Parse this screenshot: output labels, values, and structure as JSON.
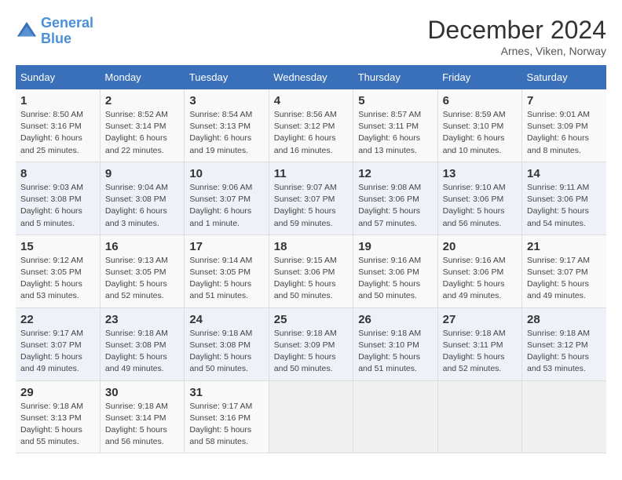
{
  "logo": {
    "line1": "General",
    "line2": "Blue"
  },
  "title": "December 2024",
  "subtitle": "Arnes, Viken, Norway",
  "days_header": [
    "Sunday",
    "Monday",
    "Tuesday",
    "Wednesday",
    "Thursday",
    "Friday",
    "Saturday"
  ],
  "weeks": [
    [
      {
        "day": "1",
        "sunrise": "Sunrise: 8:50 AM",
        "sunset": "Sunset: 3:16 PM",
        "daylight": "Daylight: 6 hours and 25 minutes."
      },
      {
        "day": "2",
        "sunrise": "Sunrise: 8:52 AM",
        "sunset": "Sunset: 3:14 PM",
        "daylight": "Daylight: 6 hours and 22 minutes."
      },
      {
        "day": "3",
        "sunrise": "Sunrise: 8:54 AM",
        "sunset": "Sunset: 3:13 PM",
        "daylight": "Daylight: 6 hours and 19 minutes."
      },
      {
        "day": "4",
        "sunrise": "Sunrise: 8:56 AM",
        "sunset": "Sunset: 3:12 PM",
        "daylight": "Daylight: 6 hours and 16 minutes."
      },
      {
        "day": "5",
        "sunrise": "Sunrise: 8:57 AM",
        "sunset": "Sunset: 3:11 PM",
        "daylight": "Daylight: 6 hours and 13 minutes."
      },
      {
        "day": "6",
        "sunrise": "Sunrise: 8:59 AM",
        "sunset": "Sunset: 3:10 PM",
        "daylight": "Daylight: 6 hours and 10 minutes."
      },
      {
        "day": "7",
        "sunrise": "Sunrise: 9:01 AM",
        "sunset": "Sunset: 3:09 PM",
        "daylight": "Daylight: 6 hours and 8 minutes."
      }
    ],
    [
      {
        "day": "8",
        "sunrise": "Sunrise: 9:03 AM",
        "sunset": "Sunset: 3:08 PM",
        "daylight": "Daylight: 6 hours and 5 minutes."
      },
      {
        "day": "9",
        "sunrise": "Sunrise: 9:04 AM",
        "sunset": "Sunset: 3:08 PM",
        "daylight": "Daylight: 6 hours and 3 minutes."
      },
      {
        "day": "10",
        "sunrise": "Sunrise: 9:06 AM",
        "sunset": "Sunset: 3:07 PM",
        "daylight": "Daylight: 6 hours and 1 minute."
      },
      {
        "day": "11",
        "sunrise": "Sunrise: 9:07 AM",
        "sunset": "Sunset: 3:07 PM",
        "daylight": "Daylight: 5 hours and 59 minutes."
      },
      {
        "day": "12",
        "sunrise": "Sunrise: 9:08 AM",
        "sunset": "Sunset: 3:06 PM",
        "daylight": "Daylight: 5 hours and 57 minutes."
      },
      {
        "day": "13",
        "sunrise": "Sunrise: 9:10 AM",
        "sunset": "Sunset: 3:06 PM",
        "daylight": "Daylight: 5 hours and 56 minutes."
      },
      {
        "day": "14",
        "sunrise": "Sunrise: 9:11 AM",
        "sunset": "Sunset: 3:06 PM",
        "daylight": "Daylight: 5 hours and 54 minutes."
      }
    ],
    [
      {
        "day": "15",
        "sunrise": "Sunrise: 9:12 AM",
        "sunset": "Sunset: 3:05 PM",
        "daylight": "Daylight: 5 hours and 53 minutes."
      },
      {
        "day": "16",
        "sunrise": "Sunrise: 9:13 AM",
        "sunset": "Sunset: 3:05 PM",
        "daylight": "Daylight: 5 hours and 52 minutes."
      },
      {
        "day": "17",
        "sunrise": "Sunrise: 9:14 AM",
        "sunset": "Sunset: 3:05 PM",
        "daylight": "Daylight: 5 hours and 51 minutes."
      },
      {
        "day": "18",
        "sunrise": "Sunrise: 9:15 AM",
        "sunset": "Sunset: 3:06 PM",
        "daylight": "Daylight: 5 hours and 50 minutes."
      },
      {
        "day": "19",
        "sunrise": "Sunrise: 9:16 AM",
        "sunset": "Sunset: 3:06 PM",
        "daylight": "Daylight: 5 hours and 50 minutes."
      },
      {
        "day": "20",
        "sunrise": "Sunrise: 9:16 AM",
        "sunset": "Sunset: 3:06 PM",
        "daylight": "Daylight: 5 hours and 49 minutes."
      },
      {
        "day": "21",
        "sunrise": "Sunrise: 9:17 AM",
        "sunset": "Sunset: 3:07 PM",
        "daylight": "Daylight: 5 hours and 49 minutes."
      }
    ],
    [
      {
        "day": "22",
        "sunrise": "Sunrise: 9:17 AM",
        "sunset": "Sunset: 3:07 PM",
        "daylight": "Daylight: 5 hours and 49 minutes."
      },
      {
        "day": "23",
        "sunrise": "Sunrise: 9:18 AM",
        "sunset": "Sunset: 3:08 PM",
        "daylight": "Daylight: 5 hours and 49 minutes."
      },
      {
        "day": "24",
        "sunrise": "Sunrise: 9:18 AM",
        "sunset": "Sunset: 3:08 PM",
        "daylight": "Daylight: 5 hours and 50 minutes."
      },
      {
        "day": "25",
        "sunrise": "Sunrise: 9:18 AM",
        "sunset": "Sunset: 3:09 PM",
        "daylight": "Daylight: 5 hours and 50 minutes."
      },
      {
        "day": "26",
        "sunrise": "Sunrise: 9:18 AM",
        "sunset": "Sunset: 3:10 PM",
        "daylight": "Daylight: 5 hours and 51 minutes."
      },
      {
        "day": "27",
        "sunrise": "Sunrise: 9:18 AM",
        "sunset": "Sunset: 3:11 PM",
        "daylight": "Daylight: 5 hours and 52 minutes."
      },
      {
        "day": "28",
        "sunrise": "Sunrise: 9:18 AM",
        "sunset": "Sunset: 3:12 PM",
        "daylight": "Daylight: 5 hours and 53 minutes."
      }
    ],
    [
      {
        "day": "29",
        "sunrise": "Sunrise: 9:18 AM",
        "sunset": "Sunset: 3:13 PM",
        "daylight": "Daylight: 5 hours and 55 minutes."
      },
      {
        "day": "30",
        "sunrise": "Sunrise: 9:18 AM",
        "sunset": "Sunset: 3:14 PM",
        "daylight": "Daylight: 5 hours and 56 minutes."
      },
      {
        "day": "31",
        "sunrise": "Sunrise: 9:17 AM",
        "sunset": "Sunset: 3:16 PM",
        "daylight": "Daylight: 5 hours and 58 minutes."
      },
      null,
      null,
      null,
      null
    ]
  ]
}
